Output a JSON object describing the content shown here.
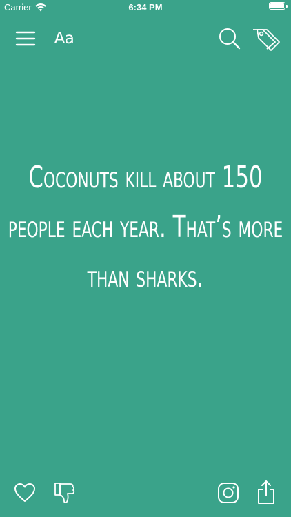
{
  "status_bar": {
    "carrier": "Carrier",
    "time": "6:34 PM",
    "battery_level": 1.0
  },
  "toolbar": {
    "font_button_label": "Aa"
  },
  "fact": {
    "text": "Coconuts kill about 150 people each year. That’s more than sharks."
  },
  "icons": {
    "menu": "hamburger-icon",
    "search": "search-icon",
    "tags": "tags-icon",
    "like": "heart-icon",
    "dislike": "thumbs-down-icon",
    "instagram": "instagram-icon",
    "share": "share-icon"
  },
  "colors": {
    "background": "#3aa38a",
    "foreground": "#ffffff"
  }
}
